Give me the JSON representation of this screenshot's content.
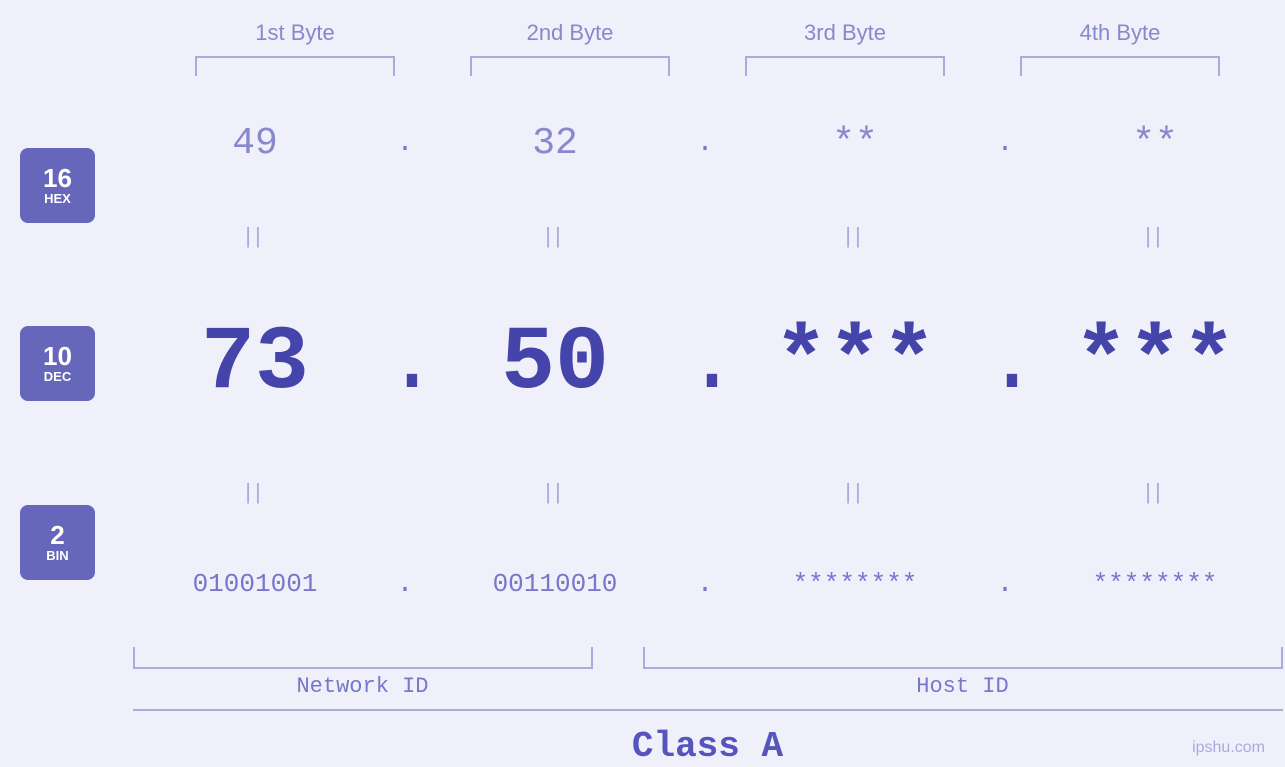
{
  "bytes": {
    "labels": [
      "1st Byte",
      "2nd Byte",
      "3rd Byte",
      "4th Byte"
    ]
  },
  "badges": [
    {
      "number": "16",
      "label": "HEX"
    },
    {
      "number": "10",
      "label": "DEC"
    },
    {
      "number": "2",
      "label": "BIN"
    }
  ],
  "hex_values": [
    "49",
    "32",
    "**",
    "**"
  ],
  "dec_values": [
    "73",
    "50",
    "***",
    "***"
  ],
  "bin_values": [
    "01001001",
    "00110010",
    "********",
    "********"
  ],
  "dots": [
    ".",
    ".",
    ".",
    ""
  ],
  "network_id_label": "Network ID",
  "host_id_label": "Host ID",
  "class_label": "Class A",
  "watermark": "ipshu.com"
}
